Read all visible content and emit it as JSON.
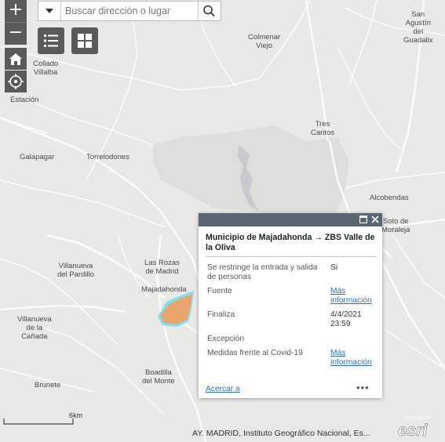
{
  "search": {
    "placeholder": "Buscar dirección o lugar"
  },
  "controls": {
    "zoom_in": "+",
    "zoom_out": "−"
  },
  "map": {
    "places": [
      {
        "name": "Collado\nVillalba"
      },
      {
        "name": "Estación"
      },
      {
        "name": "Colmenar\nViejo"
      },
      {
        "name": "San\nAgustín\ndel\nGuadalix"
      },
      {
        "name": "Tres\nCantos"
      },
      {
        "name": "Galapagar"
      },
      {
        "name": "Torrelodones"
      },
      {
        "name": "Alcobendas"
      },
      {
        "name": "Soto de\nMoraleja"
      },
      {
        "name": "Las Rozas\nde Madrid"
      },
      {
        "name": "Villanueva\ndel Pardillo"
      },
      {
        "name": "Majadahonda"
      },
      {
        "name": "Villanueva\nde la\nCañada"
      },
      {
        "name": "Boadilla\ndel Monte"
      },
      {
        "name": "Brunete"
      }
    ],
    "highlight_color": "#e9a56c",
    "highlight_outline": "#7fe0f0"
  },
  "popup": {
    "title": "Municipio de Majadahonda → ZBS Valle de la Oliva",
    "rows": [
      {
        "key": "Se restringe la entrada y salida de personas",
        "value": "Si"
      },
      {
        "key": "Fuente",
        "value": "Más información"
      },
      {
        "key": "Finaliza",
        "value": "4/4/2021 23:59"
      },
      {
        "key": "Excepción",
        "value": ""
      },
      {
        "key": "Medidas frente al Covid-19",
        "value": "Más información"
      }
    ],
    "zoom_to": "Acercar a",
    "more": "•••"
  },
  "scale": {
    "label": "6km"
  },
  "attribution": "AY. MADRID, Instituto Geográfico Nacional, Es...",
  "logo": {
    "small_text": "POWERED BY",
    "brand": "esri"
  }
}
